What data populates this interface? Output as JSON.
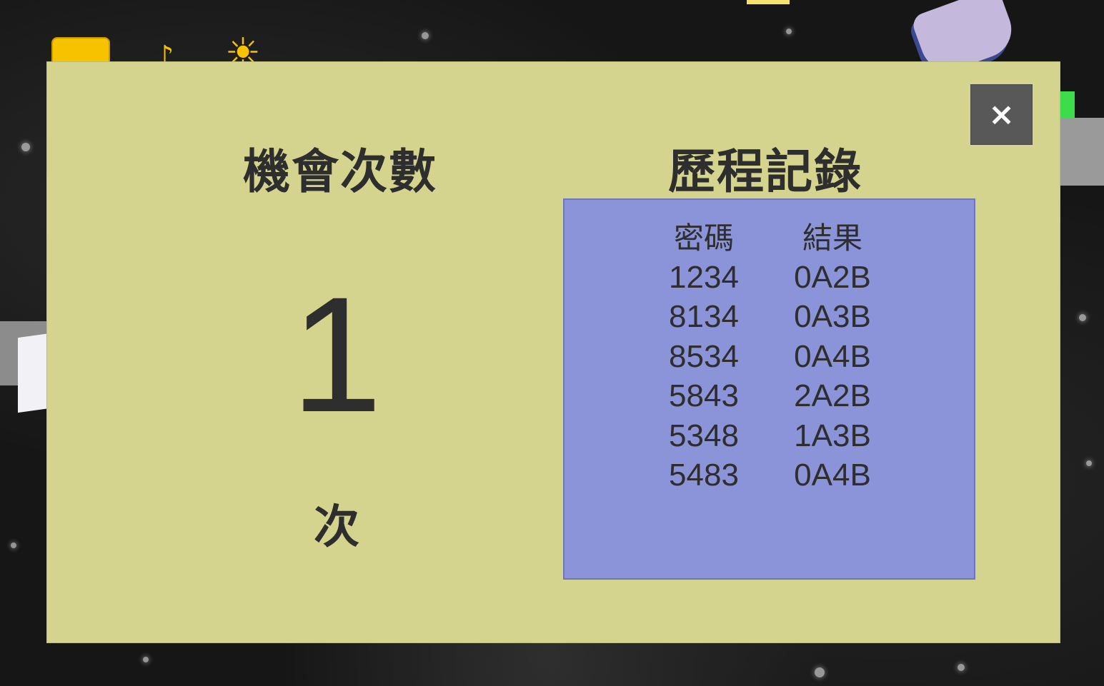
{
  "dialog": {
    "close_label": "×",
    "chances": {
      "title": "機會次數",
      "count": "1",
      "unit": "次"
    },
    "history": {
      "title": "歷程記錄",
      "columns": [
        "密碼",
        "結果"
      ],
      "rows": [
        {
          "code": "1234",
          "result": "0A2B"
        },
        {
          "code": "8134",
          "result": "0A3B"
        },
        {
          "code": "8534",
          "result": "0A4B"
        },
        {
          "code": "5843",
          "result": "2A2B"
        },
        {
          "code": "5348",
          "result": "1A3B"
        },
        {
          "code": "5483",
          "result": "0A4B"
        }
      ]
    }
  },
  "background_icons": [
    "folder-icon",
    "music-note-icon",
    "sun-icon"
  ],
  "colors": {
    "panel": "#d4d48f",
    "history_box": "#8b94d8",
    "close_button": "#585858",
    "text": "#2e2e2e"
  }
}
